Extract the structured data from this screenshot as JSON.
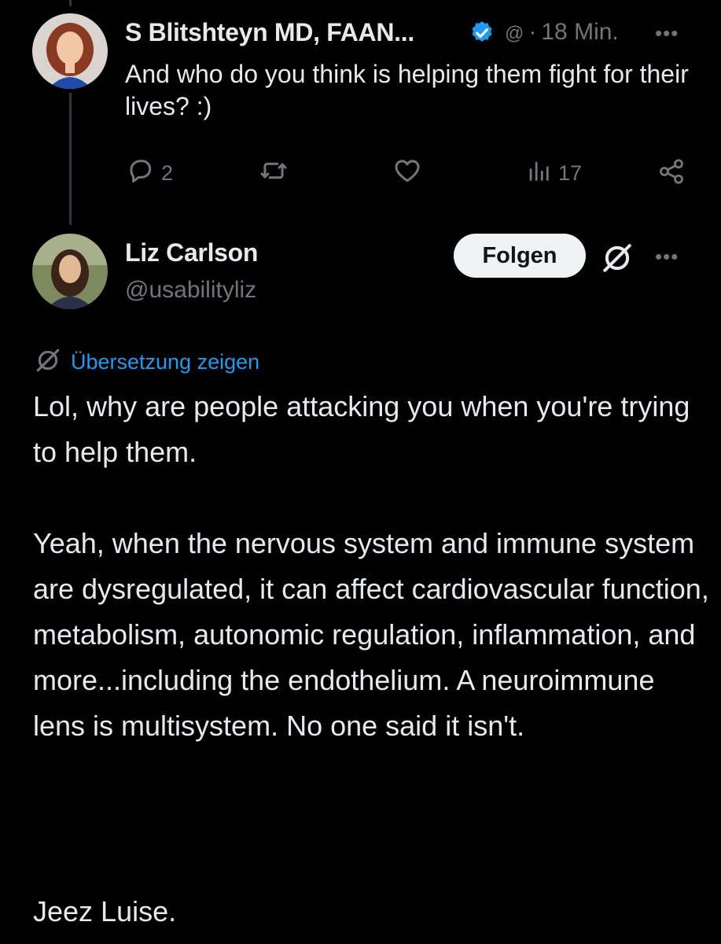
{
  "tweet1": {
    "author_name": "S Blitshteyn MD, FAAN...",
    "handle_fragment": "@",
    "separator": "·",
    "time": "18 Min.",
    "more": "•••",
    "text": "And who do you think is helping them fight for their lives? :)",
    "actions": {
      "replies": "2",
      "views": "17"
    },
    "verified_color": "#1d9bf0"
  },
  "tweet2": {
    "author_name": "Liz Carlson",
    "handle": "@usabilityliz",
    "follow_label": "Folgen",
    "more": "•••",
    "translate_label": "Übersetzung zeigen",
    "paragraphs": [
      "Lol, why are people attacking you when you're trying to help them.",
      "Yeah, when the nervous system and immune system are dysregulated, it can affect cardiovascular function, metabolism, autonomic regulation, inflammation, and more...including the endothelium. A neuroimmune lens is multisystem. No one said it isn't.",
      "Jeez Luise."
    ]
  },
  "colors": {
    "background": "#000000",
    "text": "#e7e9ea",
    "muted": "#71767b",
    "link": "#1d9bf0",
    "button_bg": "#eff3f4"
  }
}
